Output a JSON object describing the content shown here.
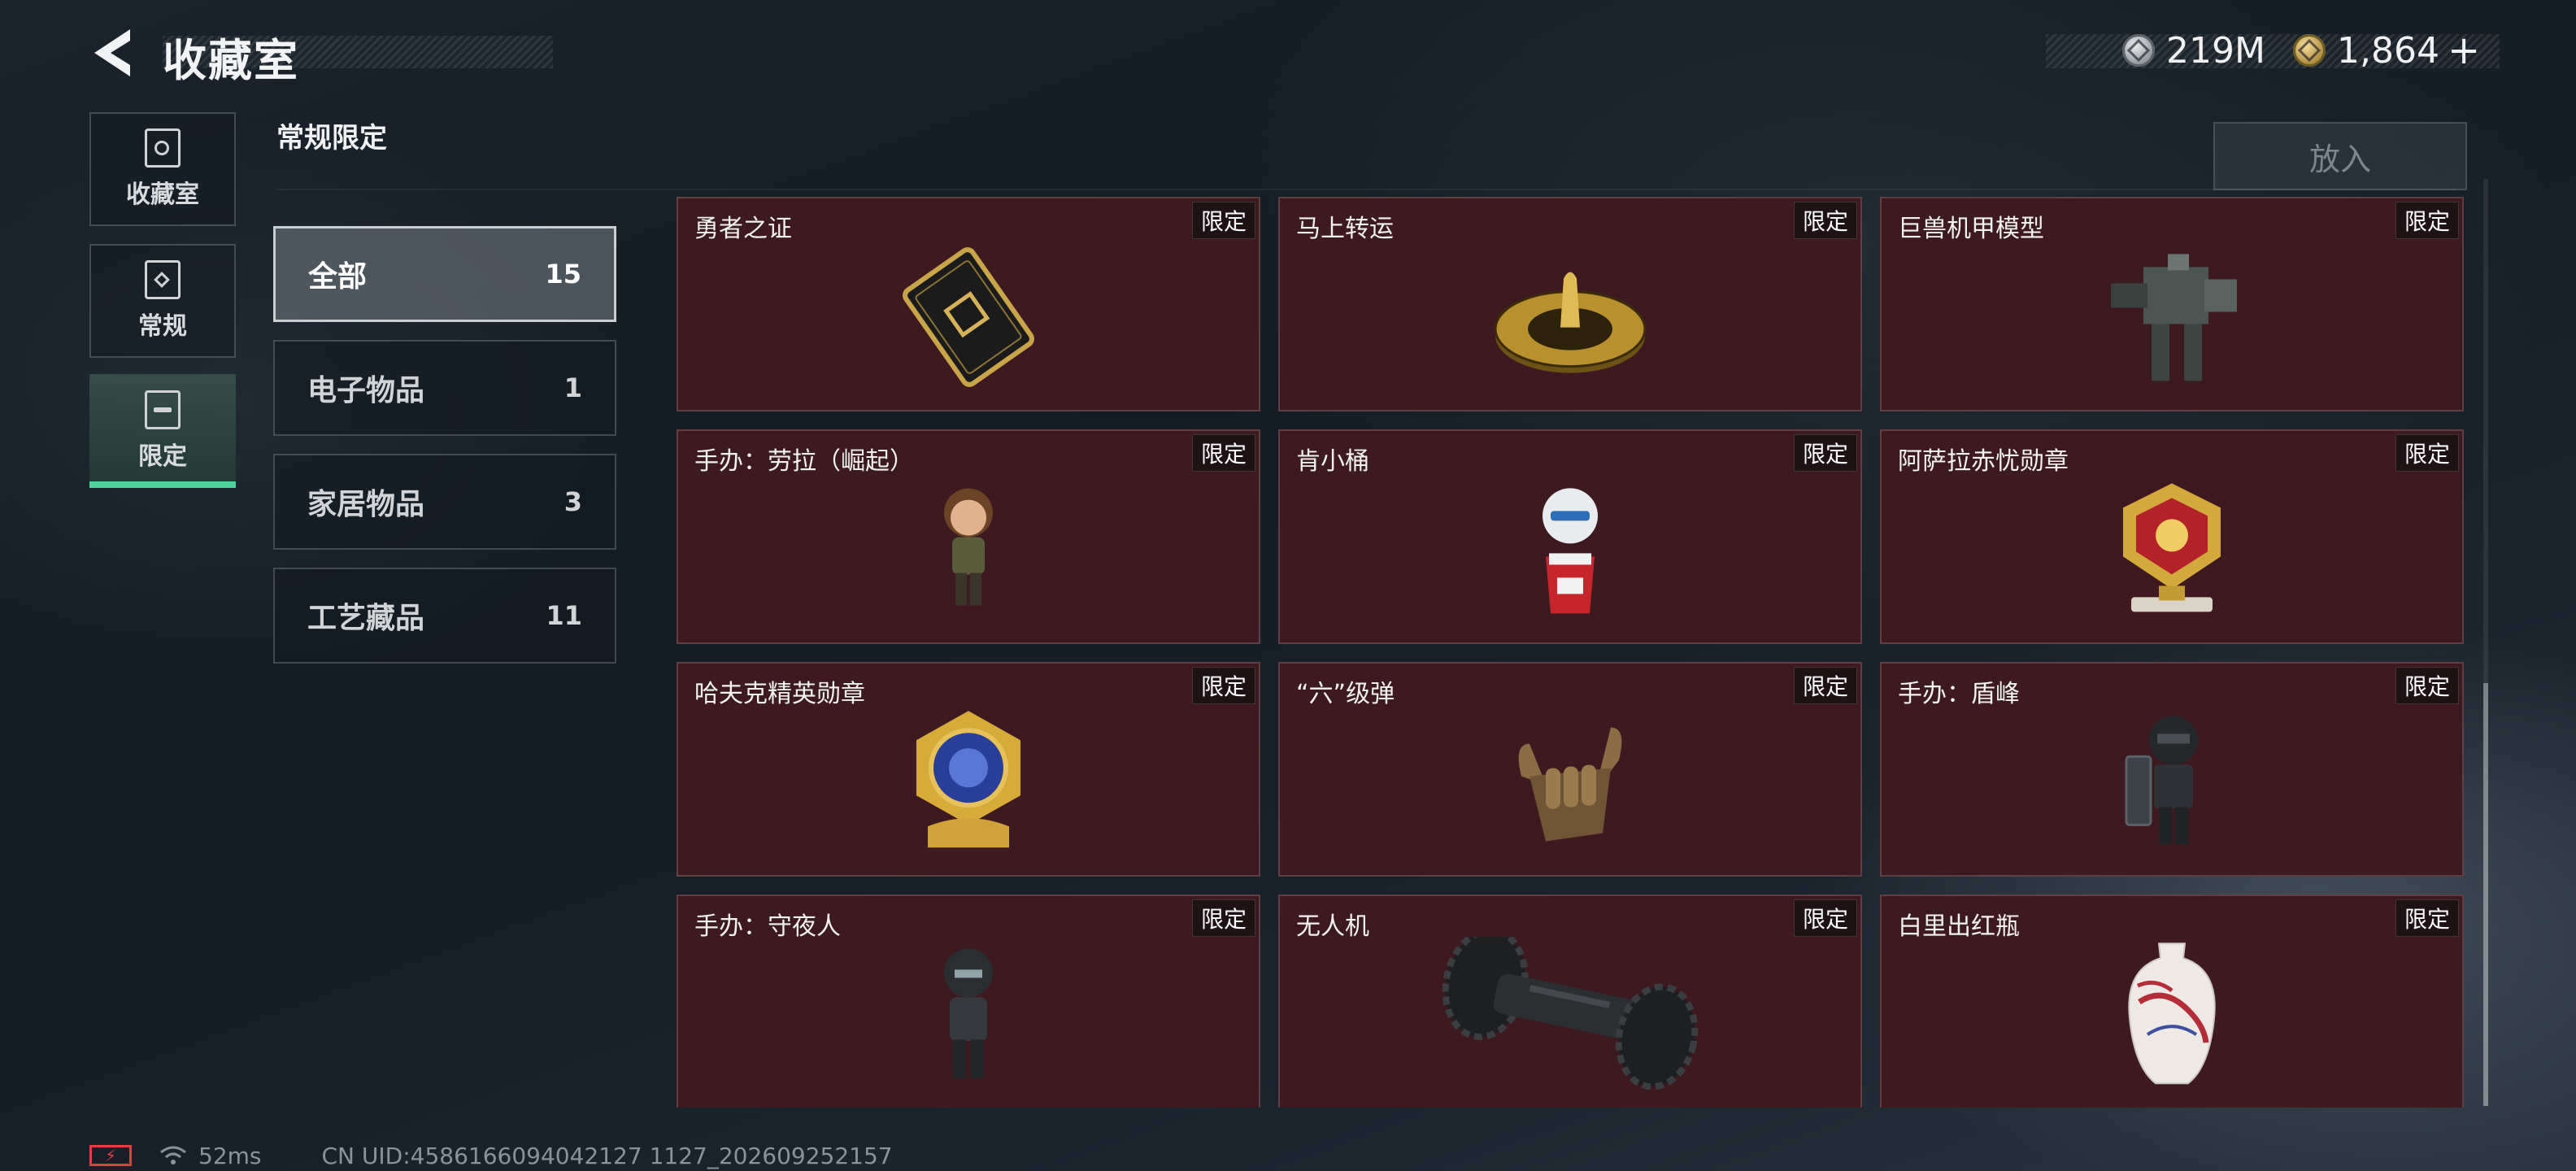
{
  "header": {
    "title": "收藏室",
    "currency_silver": "219M",
    "currency_gold": "1,864",
    "plus_label": "+"
  },
  "nav": [
    {
      "label": "收藏室",
      "icon": "collection-icon"
    },
    {
      "label": "常规",
      "icon": "regular-icon"
    },
    {
      "label": "限定",
      "icon": "limited-icon",
      "active": true
    }
  ],
  "section": {
    "title": "常规限定",
    "place_button": "放入"
  },
  "categories": [
    {
      "name": "全部",
      "count": "15",
      "active": true
    },
    {
      "name": "电子物品",
      "count": "1"
    },
    {
      "name": "家居物品",
      "count": "3"
    },
    {
      "name": "工艺藏品",
      "count": "11"
    }
  ],
  "badge_label": "限定",
  "items": [
    {
      "title": "勇者之证",
      "icon": "card-icon"
    },
    {
      "title": "马上转运",
      "icon": "spinner-disc-icon"
    },
    {
      "title": "巨兽机甲模型",
      "icon": "mech-model-icon"
    },
    {
      "title": "手办：劳拉（崛起）",
      "icon": "lara-figure-icon"
    },
    {
      "title": "肯小桶",
      "icon": "colonel-figure-icon"
    },
    {
      "title": "阿萨拉赤忧勋章",
      "icon": "red-medal-icon"
    },
    {
      "title": "哈夫克精英勋章",
      "icon": "blue-medal-icon"
    },
    {
      "title": "“六”级弹",
      "icon": "bullet-hand-icon"
    },
    {
      "title": "手办：盾峰",
      "icon": "shield-figure-icon"
    },
    {
      "title": "手办：守夜人",
      "icon": "nightwatch-figure-icon"
    },
    {
      "title": "无人机",
      "icon": "drone-icon"
    },
    {
      "title": "白里出红瓶",
      "icon": "vase-icon"
    }
  ],
  "footer": {
    "ping": "52ms",
    "uid": "CN UID:4586166094042127 1127_202609252157"
  }
}
